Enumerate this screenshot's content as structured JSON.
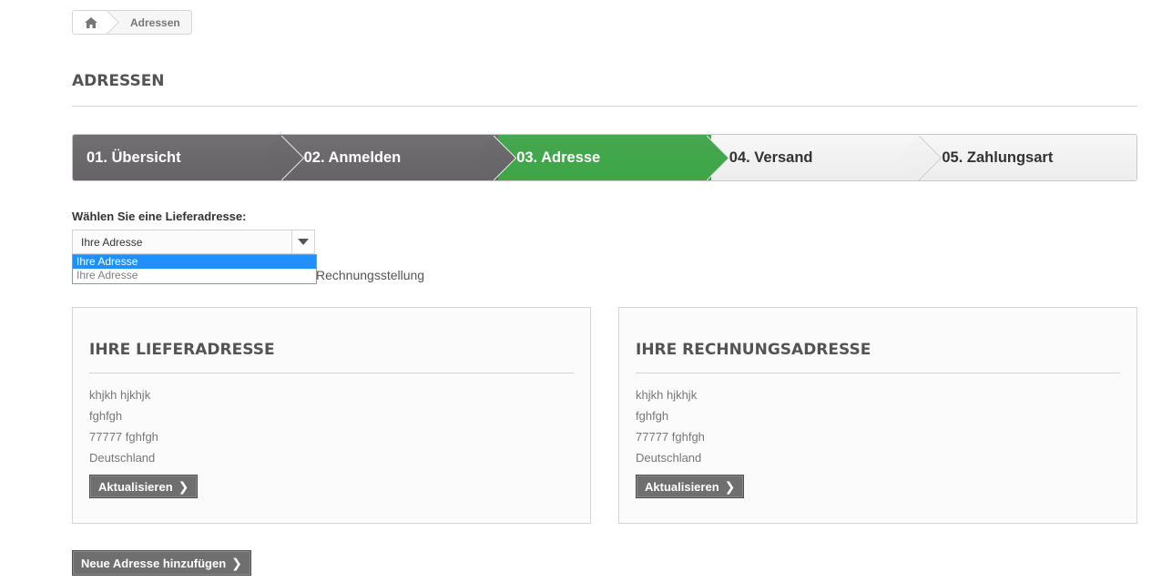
{
  "breadcrumb": {
    "home_icon": "home-icon",
    "current": "Adressen"
  },
  "page": {
    "heading": "ADRESSEN"
  },
  "steps": [
    {
      "label": "01. Übersicht",
      "state": "done"
    },
    {
      "label": "02. Anmelden",
      "state": "done"
    },
    {
      "label": "03. Adresse",
      "state": "current"
    },
    {
      "label": "04. Versand",
      "state": "todo"
    },
    {
      "label": "05. Zahlungsart",
      "state": "todo"
    }
  ],
  "delivery_select": {
    "label": "Wählen Sie eine Lieferadresse:",
    "value": "Ihre Adresse",
    "options": [
      "Ihre Adresse",
      "Ihre Adresse"
    ]
  },
  "billing_checkbox_text": "Rechnungsstellung",
  "delivery_address": {
    "title": "IHRE LIEFERADRESSE",
    "lines": [
      "khjkh hjkhjk",
      "fghfgh",
      "77777 fghfgh",
      "Deutschland"
    ],
    "button": "Aktualisieren"
  },
  "billing_address": {
    "title": "IHRE RECHNUNGSADRESSE",
    "lines": [
      "khjkh hjkhjk",
      "fghfgh",
      "77777 fghfgh",
      "Deutschland"
    ],
    "button": "Aktualisieren"
  },
  "new_address_button": "Neue Adresse hinzufügen",
  "colors": {
    "step_done": "#6b686b",
    "step_current": "#43a64c",
    "step_todo": "#f2f2f2",
    "button_dark": "#6f6f6f"
  }
}
